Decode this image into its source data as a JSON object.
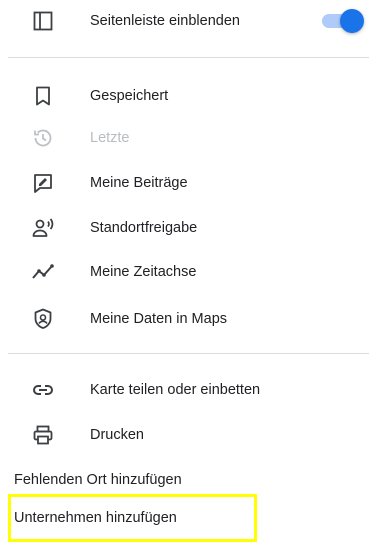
{
  "menu": {
    "sidebar_toggle": {
      "label": "Seitenleiste einblenden",
      "icon": "sidebar-panel-icon",
      "enabled": true,
      "accent": "#1a73e8"
    },
    "items": [
      {
        "label": "Gespeichert",
        "icon": "bookmark-icon"
      },
      {
        "label": "Letzte",
        "icon": "history-icon",
        "disabled": true
      },
      {
        "label": "Meine Beiträge",
        "icon": "contributions-icon"
      },
      {
        "label": "Standortfreigabe",
        "icon": "location-sharing-icon"
      },
      {
        "label": "Meine Zeitachse",
        "icon": "timeline-icon"
      },
      {
        "label": "Meine Daten in Maps",
        "icon": "shield-icon"
      }
    ],
    "share_items": [
      {
        "label": "Karte teilen oder einbetten",
        "icon": "link-icon"
      },
      {
        "label": "Drucken",
        "icon": "print-icon"
      }
    ],
    "text_items": [
      {
        "label": "Fehlenden Ort hinzufügen"
      },
      {
        "label": "Unternehmen hinzufügen",
        "highlighted": true
      }
    ],
    "highlight_color": "#ffff00"
  }
}
